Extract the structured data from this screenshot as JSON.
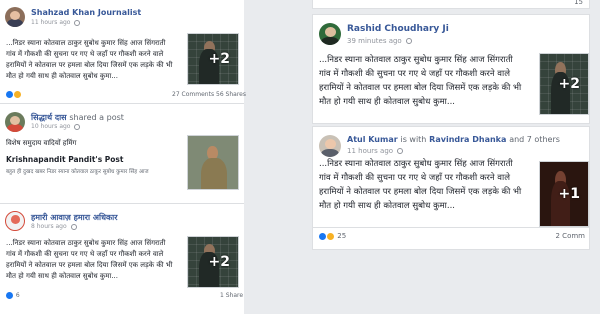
{
  "left_column": {
    "posts": [
      {
        "author": "Shahzad Khan Journalist",
        "time": "11 hours ago",
        "text": "...निडर स्याना कोतवाल ठाकुर सुबोध कुमार सिंह आज सिंगराती\nगांव में गौकशी की सुचना पर गए थे जहाँ पर गौकशी करने वाले\nहरामियों ने कोतवाल पर हमला बोल दिया जिसमें एक लड़के की भी\nमौत हो गयी साथ ही कोतवाल सुबोध कुमा...",
        "image_more": "+2",
        "reaction_count": "",
        "comments": "27 Comments",
        "shares": "56 Shares"
      },
      {
        "author": "सिद्धार्थ दास",
        "author_suffix": "shared a post",
        "time": "10 hours ago",
        "text": "विशेष समुदाय वादियों हमिंग",
        "shared_from": "Krishnapandit Pandit's Post",
        "shared_text": "बहुत ही दुखद खबर निडर स्याना कोतवाल ठाकुर सुबोध कुमार सिंह आज",
        "image_more": ""
      },
      {
        "author": "हमारी आवाज़ हमारा अधिकार",
        "time": "8 hours ago",
        "text": "...निडर स्याना कोतवाल ठाकुर सुबोध कुमार सिंह आज सिंगराती\nगांव में गौकशी की सुचना पर गए थे जहाँ पर गौकशी करने वाले\nहरामियों ने कोतवाल पर हमला बोल दिया जिसमें एक लड़के की भी\nमौत हो गयी साथ ही कोतवाल सुबोध कुमा...",
        "image_more": "+2",
        "reaction_count": "6",
        "shares": "1 Share"
      }
    ]
  },
  "right_column": {
    "top_stub": "15",
    "posts": [
      {
        "author": "Rashid Choudhary Ji",
        "time": "39 minutes ago",
        "text": "...निडर स्याना कोतवाल ठाकुर सुबोध कुमार सिंह आज सिंगराती\nगांव में गौकशी की सुचना पर गए थे जहाँ पर गौकशी करने वाले\nहरामियों ने कोतवाल पर हमला बोल दिया जिसमें एक लड़के की भी\nमौत हो गयी साथ ही कोतवाल सुबोध कुमा...",
        "image_more": "+2"
      },
      {
        "author": "Atul Kumar",
        "author_mid": "is with",
        "with_name": "Ravindra Dhanka",
        "others": "and 7 others",
        "time": "11 hours ago",
        "text": "...निडर स्याना कोतवाल ठाकुर सुबोध कुमार सिंह आज सिंगराती\nगांव में गौकशी की सुचना पर गए थे जहाँ पर गौकशी करने वाले\nहरामियों ने कोतवाल पर हमला बोल दिया जिसमें एक लड़के की भी\nमौत हो गयी साथ ही कोतवाल सुबोध कुमा...",
        "image_more": "+1",
        "reaction_count": "25",
        "comments": "2 Comm"
      }
    ]
  },
  "colors": {
    "link": "#385898",
    "like": "#1877f2",
    "haha": "#f7b125",
    "muted": "#90949c"
  }
}
